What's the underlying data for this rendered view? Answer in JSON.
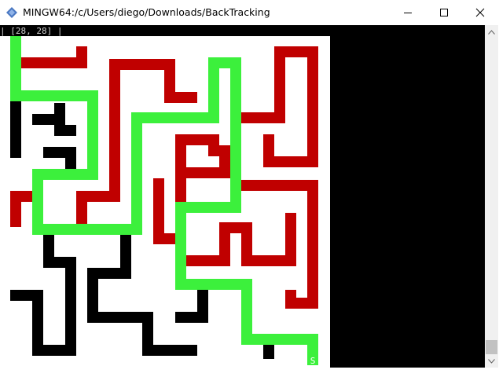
{
  "window": {
    "title": "MINGW64:/c/Users/diego/Downloads/BackTracking",
    "minimize_icon": "minimize-icon",
    "maximize_icon": "maximize-icon",
    "close_icon": "close-icon"
  },
  "terminal": {
    "status_text": "| [28, 28] |",
    "goal_marker": "S"
  },
  "colors": {
    "background": "#000000",
    "maze_floor": "#ffffff",
    "wall_black": "#000000",
    "visited_path": "#c00000",
    "solution_path": "#3cf03c"
  }
}
